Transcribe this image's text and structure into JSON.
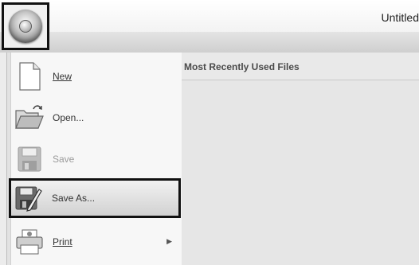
{
  "window": {
    "title": "Untitled"
  },
  "menu": {
    "mru_title": "Most Recently Used Files",
    "items": [
      {
        "label": "New",
        "mnemonic_index": 0,
        "enabled": true
      },
      {
        "label": "Open...",
        "mnemonic_index": 0,
        "enabled": true
      },
      {
        "label": "Save",
        "mnemonic_index": 0,
        "enabled": false
      },
      {
        "label": "Save As...",
        "mnemonic_index": 5,
        "enabled": true,
        "selected": true
      },
      {
        "label": "Print",
        "mnemonic_index": 0,
        "enabled": true,
        "has_submenu": true
      }
    ]
  },
  "icons": {
    "app_button": "app-orb-icon",
    "new": "new-document-icon",
    "open": "open-folder-icon",
    "save": "save-disk-icon",
    "save_as": "save-as-icon",
    "print": "printer-icon",
    "submenu": "chevron-right-icon"
  }
}
